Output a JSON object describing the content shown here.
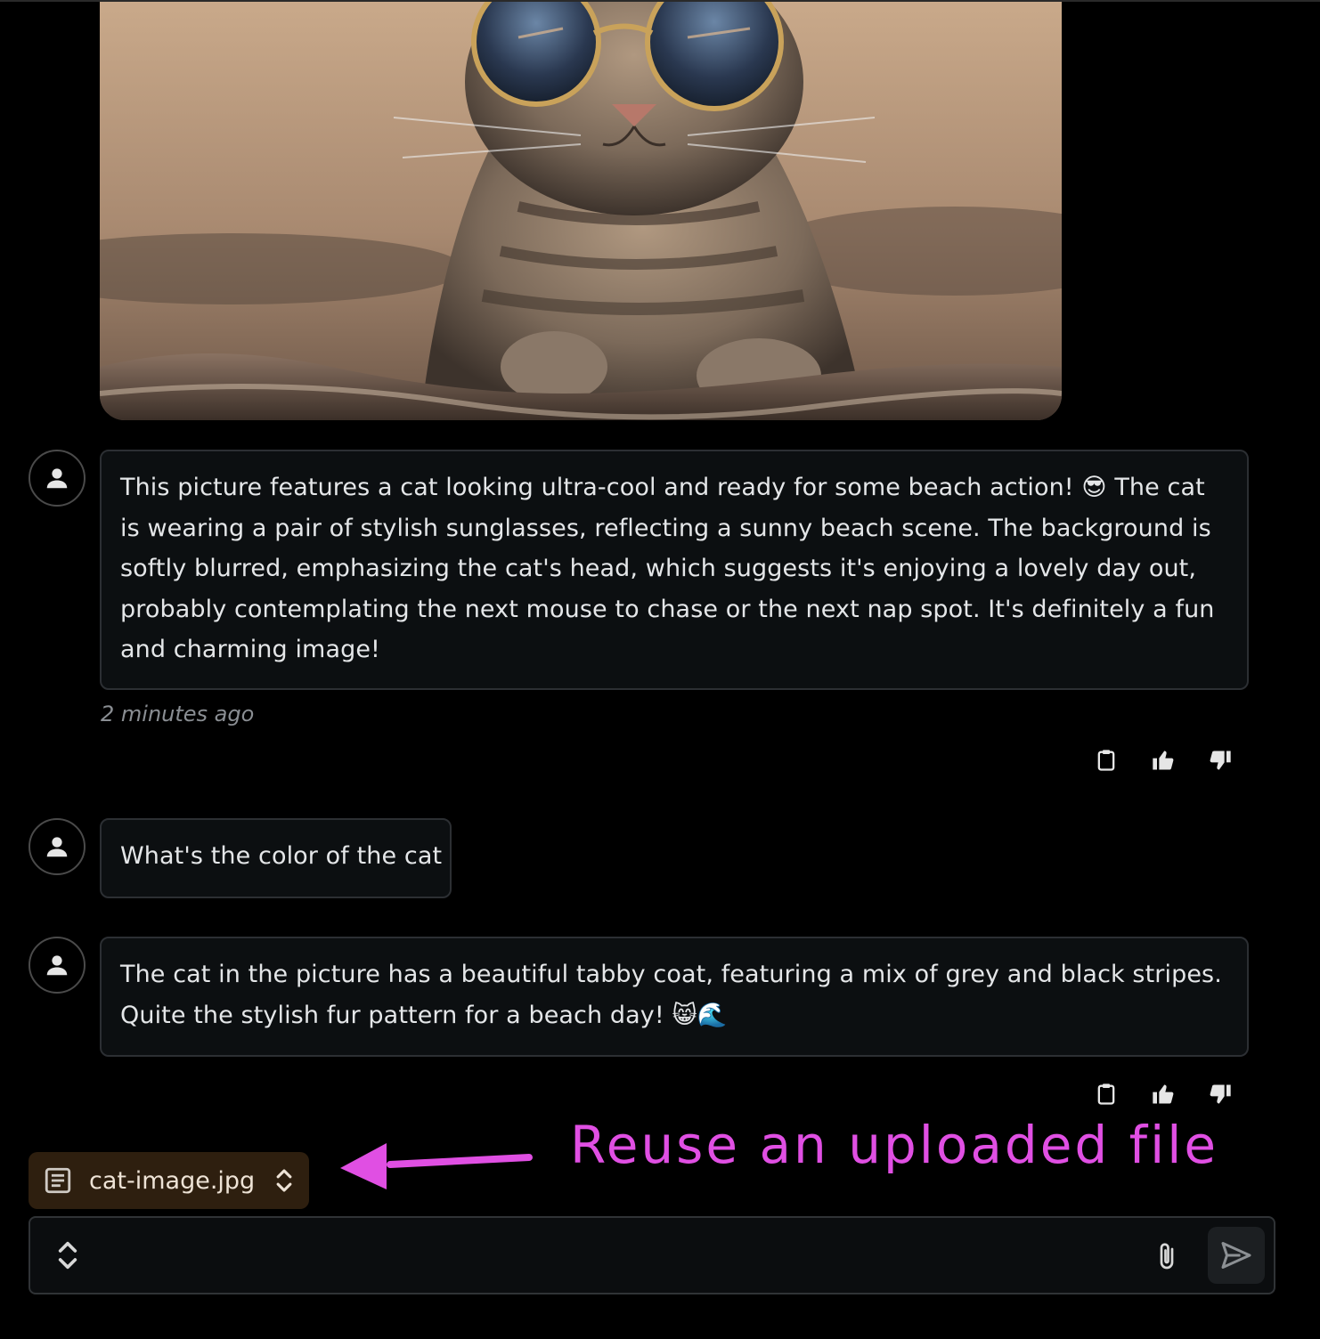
{
  "messages": [
    {
      "text": "This picture features a cat looking ultra-cool and ready for some beach action! 😎 The cat is wearing a pair of stylish sunglasses, reflecting a sunny beach scene. The background is softly blurred, emphasizing the cat's head, which suggests it's enjoying a lovely day out, probably contemplating the next mouse to chase or the next nap spot. It's definitely a fun and charming image!",
      "timestamp": "2 minutes ago"
    },
    {
      "text": "What's the color of the cat"
    },
    {
      "text": "The cat in the picture has a beautiful tabby coat, featuring a mix of grey and black stripes. Quite the stylish fur pattern for a beach day! 😸🌊"
    }
  ],
  "icons": {
    "avatar": "user-icon",
    "copy": "clipboard-icon",
    "like": "thumbs-up-icon",
    "dislike": "thumbs-down-icon",
    "file": "document-icon",
    "file_switch": "chevron-up-down-icon",
    "expand": "chevron-up-down-icon",
    "attach": "paperclip-icon",
    "send": "send-icon"
  },
  "file_chip": {
    "filename": "cat-image.jpg"
  },
  "annotation": {
    "text": "Reuse an uploaded file",
    "color": "#e04fe3"
  },
  "composer": {
    "value": ""
  },
  "colors": {
    "background": "#000000",
    "bubble": "#0c0f11",
    "bubble_border": "#2c2f33",
    "file_chip": "#2e1f0f"
  }
}
